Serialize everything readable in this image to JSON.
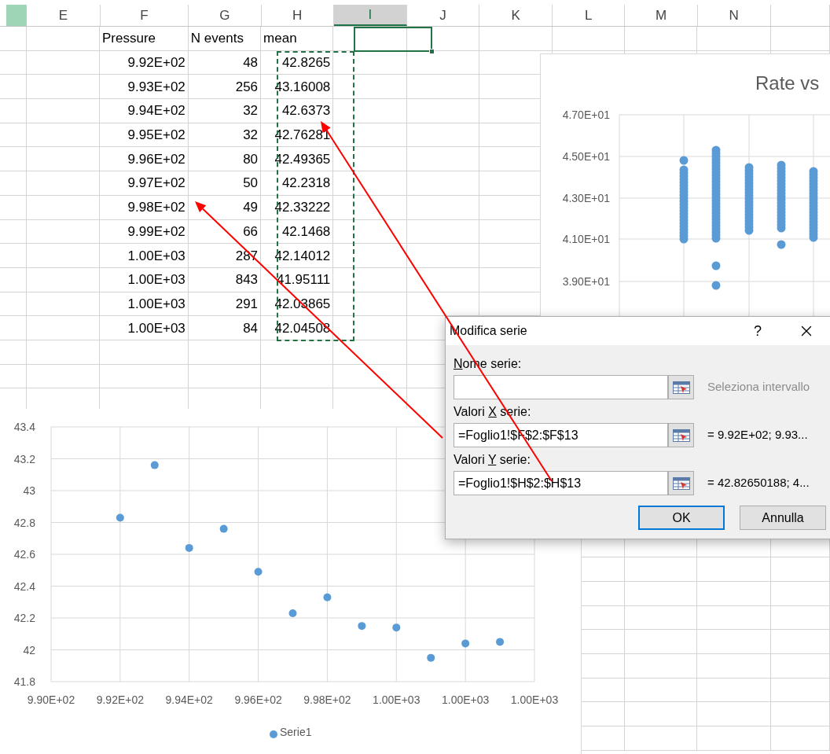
{
  "columns": [
    {
      "label": "E",
      "selected": false,
      "marquee": false
    },
    {
      "label": "F",
      "selected": false,
      "marquee": false
    },
    {
      "label": "G",
      "selected": false,
      "marquee": false
    },
    {
      "label": "H",
      "selected": false,
      "marquee": true
    },
    {
      "label": "I",
      "selected": true,
      "marquee": false
    },
    {
      "label": "J",
      "selected": false,
      "marquee": false
    },
    {
      "label": "K",
      "selected": false,
      "marquee": false
    },
    {
      "label": "L",
      "selected": false,
      "marquee": false
    },
    {
      "label": "M",
      "selected": false,
      "marquee": false
    },
    {
      "label": "N",
      "selected": false,
      "marquee": false
    }
  ],
  "rows": [
    {
      "kind": "header",
      "cells": [
        "Pressure",
        "N events",
        "mean"
      ]
    },
    {
      "kind": "data",
      "cells": [
        "9.92E+02",
        "48",
        "42.8265"
      ]
    },
    {
      "kind": "data",
      "cells": [
        "9.93E+02",
        "256",
        "43.16008"
      ]
    },
    {
      "kind": "data",
      "cells": [
        "9.94E+02",
        "32",
        "42.6373"
      ]
    },
    {
      "kind": "data",
      "cells": [
        "9.95E+02",
        "32",
        "42.76281"
      ]
    },
    {
      "kind": "data",
      "cells": [
        "9.96E+02",
        "80",
        "42.49365"
      ]
    },
    {
      "kind": "data",
      "cells": [
        "9.97E+02",
        "50",
        "42.2318"
      ]
    },
    {
      "kind": "data",
      "cells": [
        "9.98E+02",
        "49",
        "42.33222"
      ]
    },
    {
      "kind": "data",
      "cells": [
        "9.99E+02",
        "66",
        "42.1468"
      ]
    },
    {
      "kind": "data",
      "cells": [
        "1.00E+03",
        "287",
        "42.14012"
      ]
    },
    {
      "kind": "data",
      "cells": [
        "1.00E+03",
        "843",
        "41.95111"
      ]
    },
    {
      "kind": "data",
      "cells": [
        "1.00E+03",
        "291",
        "42.03865"
      ]
    },
    {
      "kind": "data",
      "cells": [
        "1.00E+03",
        "84",
        "42.04508"
      ]
    }
  ],
  "right_chart": {
    "title": "Rate vs",
    "y_tick_labels": [
      "4.70E+01",
      "4.50E+01",
      "4.30E+01",
      "4.10E+01",
      "3.90E+01"
    ]
  },
  "scatter_chart": {
    "chart_data": {
      "type": "scatter",
      "x": [
        992,
        993,
        994,
        995,
        996,
        997,
        998,
        999,
        1000,
        1001,
        1002,
        1003
      ],
      "series": [
        {
          "name": "Serie1",
          "color": "#5b9bd5",
          "values": [
            42.83,
            43.16,
            42.64,
            42.76,
            42.49,
            42.23,
            42.33,
            42.15,
            42.14,
            41.95,
            42.04,
            42.05
          ]
        }
      ],
      "grid": true,
      "xlim": [
        990,
        1004
      ],
      "ylim": [
        41.8,
        43.4
      ],
      "xticks": [
        {
          "value": 990,
          "label": "9.90E+02"
        },
        {
          "value": 992,
          "label": "9.92E+02"
        },
        {
          "value": 994,
          "label": "9.94E+02"
        },
        {
          "value": 996,
          "label": "9.96E+02"
        },
        {
          "value": 998,
          "label": "9.98E+02"
        },
        {
          "value": 1000,
          "label": "1.00E+03"
        },
        {
          "value": 1002,
          "label": "1.00E+03"
        },
        {
          "value": 1004,
          "label": "1.00E+03"
        }
      ],
      "yticks": [
        41.8,
        42,
        42.2,
        42.4,
        42.6,
        42.8,
        43,
        43.2,
        43.4
      ]
    }
  },
  "dialog": {
    "title": "Modifica serie",
    "help": "?",
    "fields": [
      {
        "mnemonic": "N",
        "label_after": "ome serie:",
        "preview": "Seleziona intervallo",
        "preview_dimmed": true
      },
      {
        "label_before": "Valori ",
        "mnemonic": "X",
        "label_after": " serie:",
        "value": "=Foglio1!$F$2:$F$13",
        "preview": "= 9.92E+02; 9.93...",
        "preview_dimmed": false
      },
      {
        "label_before": "Valori ",
        "mnemonic": "Y",
        "label_after": " serie:",
        "value": "=Foglio1!$H$2:$H$13",
        "preview": "= 42.82650188; 4...",
        "preview_dimmed": false
      }
    ],
    "buttons": [
      {
        "label": "OK",
        "default": true
      },
      {
        "label": "Annulla",
        "default": false
      }
    ]
  }
}
